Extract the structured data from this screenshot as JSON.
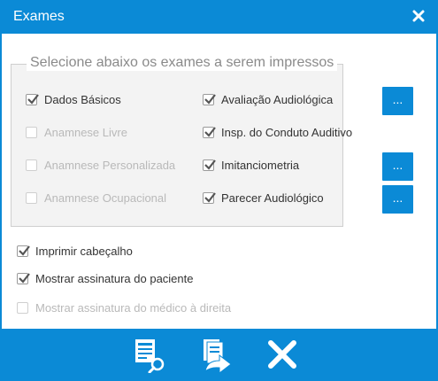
{
  "window": {
    "title": "Exames"
  },
  "group": {
    "legend": "Selecione abaixo os exames a serem impressos",
    "left_options": [
      {
        "label": "Dados Básicos",
        "checked": true,
        "enabled": true
      },
      {
        "label": "Anamnese Livre",
        "checked": false,
        "enabled": false
      },
      {
        "label": "Anamnese Personalizada",
        "checked": false,
        "enabled": false
      },
      {
        "label": "Anamnese Ocupacional",
        "checked": false,
        "enabled": false
      }
    ],
    "right_options": [
      {
        "label": "Avaliação Audiológica",
        "checked": true,
        "enabled": true,
        "has_button": true
      },
      {
        "label": "Insp. do Conduto Auditivo",
        "checked": true,
        "enabled": true,
        "has_button": false
      },
      {
        "label": "Imitanciometria",
        "checked": true,
        "enabled": true,
        "has_button": true
      },
      {
        "label": "Parecer Audiológico",
        "checked": true,
        "enabled": true,
        "has_button": true
      }
    ],
    "button_label": "..."
  },
  "print_options": [
    {
      "label": "Imprimir cabeçalho",
      "checked": true,
      "enabled": true
    },
    {
      "label": "Mostrar assinatura do paciente",
      "checked": true,
      "enabled": true
    },
    {
      "label": "Mostrar assinatura do médico à direita",
      "checked": false,
      "enabled": false
    }
  ],
  "footer": {
    "icons": [
      "preview-document-icon",
      "export-document-icon",
      "close-icon"
    ]
  },
  "colors": {
    "accent": "#0b8ad6",
    "disabled_text": "#b9b9b9"
  }
}
